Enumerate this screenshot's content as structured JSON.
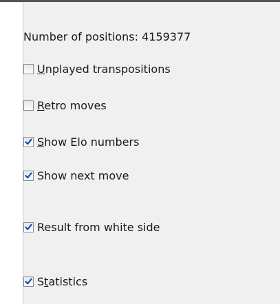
{
  "positions": {
    "label": "Number of positions: 4159377"
  },
  "options": [
    {
      "pre": "",
      "key": "U",
      "post": "nplayed transpositions",
      "checked": false
    },
    {
      "pre": "",
      "key": "R",
      "post": "etro moves",
      "checked": false
    },
    {
      "pre": "",
      "key": "S",
      "post": "how Elo numbers",
      "checked": true
    },
    {
      "pre": "",
      "key": "",
      "post": "Show next move",
      "checked": true
    },
    {
      "pre": "",
      "key": "",
      "post": "Result from white side",
      "checked": true
    },
    {
      "pre": "S",
      "key": "t",
      "post": "atistics",
      "checked": true
    }
  ],
  "colors": {
    "panel": "#f0f0f0",
    "checkmark": "#1c4d9c"
  }
}
